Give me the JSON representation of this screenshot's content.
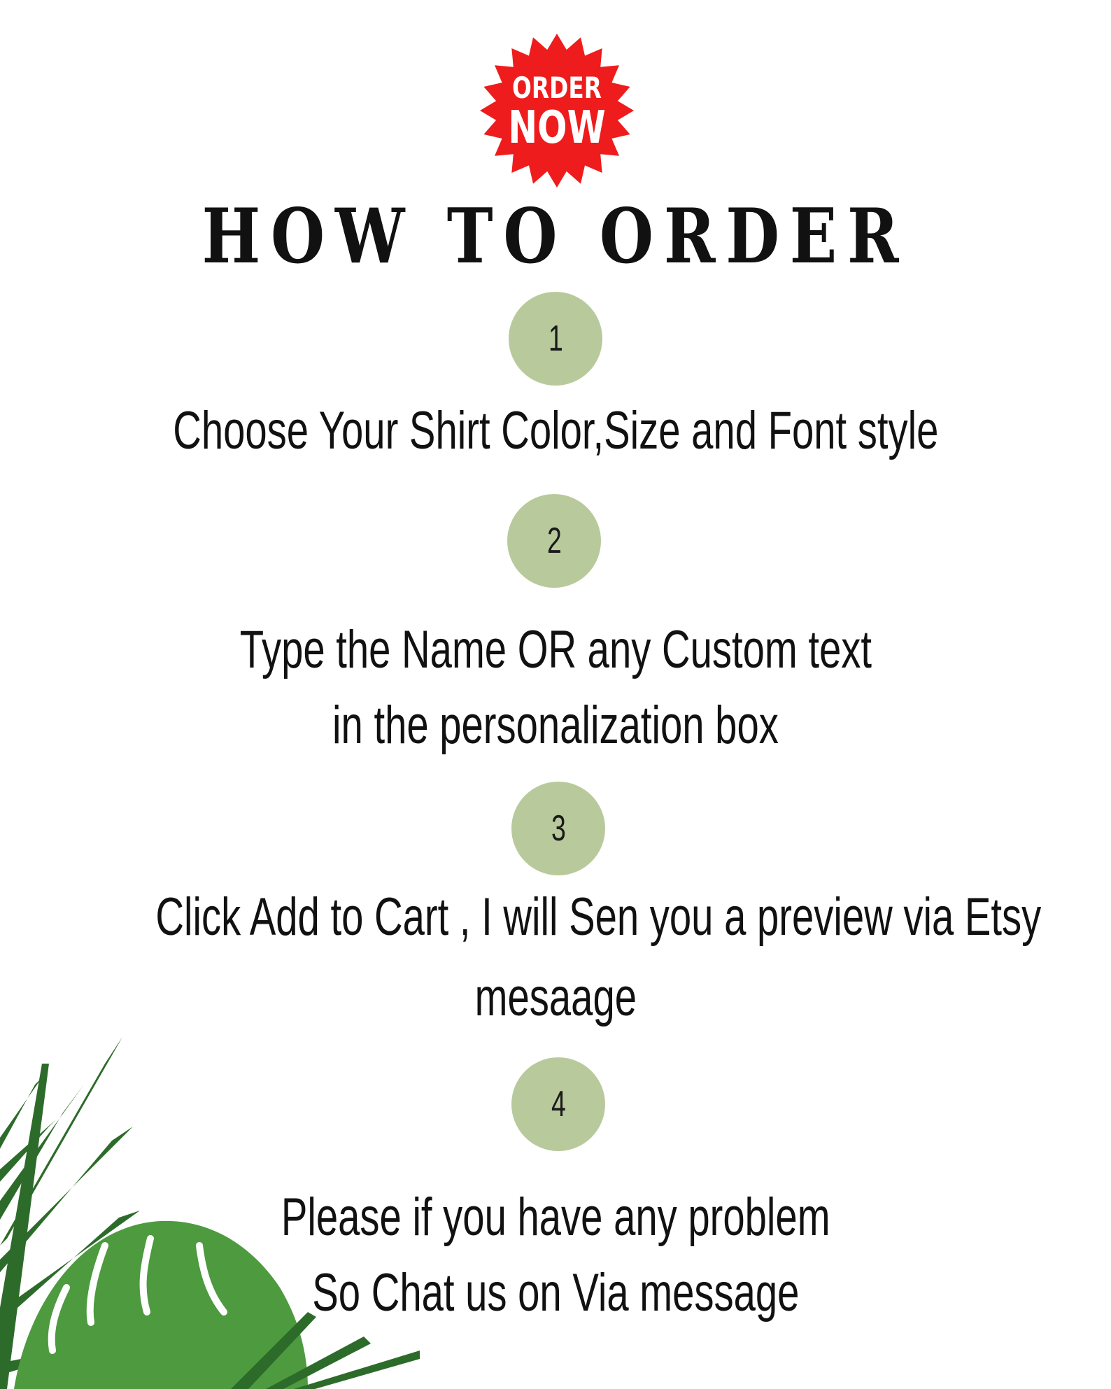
{
  "badge": {
    "line1": "ORDER",
    "line2": "NOW",
    "color": "#ee1c1c"
  },
  "title": "HOW TO ORDER",
  "steps": [
    {
      "number": "1",
      "lines": [
        "Choose Your Shirt Color,Size and Font style"
      ]
    },
    {
      "number": "2",
      "lines": [
        "Type the Name OR any Custom text",
        "in the personalization box"
      ]
    },
    {
      "number": "3",
      "lines": [
        "Click Add to Cart , I will Sen you a preview via Etsy",
        "mesaage"
      ]
    },
    {
      "number": "4",
      "lines": [
        "Please if you have any problem",
        "So Chat us on Via message"
      ]
    }
  ],
  "colors": {
    "circle": "#b8ca9c",
    "leaf_dark": "#2d6b2a",
    "leaf_mid": "#4d9a3f"
  },
  "decoration_icon": "tropical-leaves-icon"
}
